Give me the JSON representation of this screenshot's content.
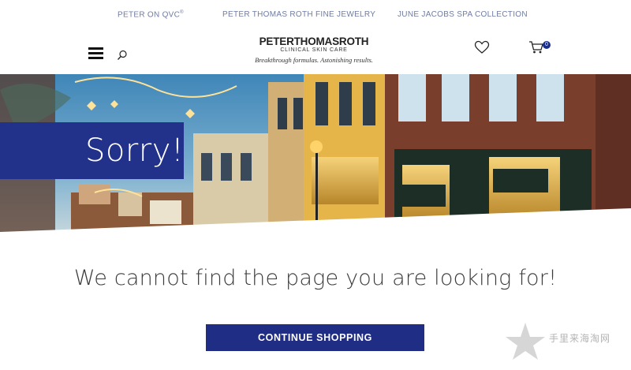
{
  "top_links": {
    "qvc": "PETER ON QVC",
    "qvc_mark": "®",
    "jewelry": "PETER THOMAS ROTH FINE JEWELRY",
    "spa": "JUNE JACOBS SPA COLLECTION"
  },
  "header": {
    "logo_brand": "PETERTHOMASROTH",
    "logo_sub": "CLINICAL SKIN CARE",
    "logo_tagline": "Breakthrough formulas. Astonishing results.",
    "cart_count": "0",
    "icons": [
      "menu-icon",
      "search-icon",
      "heart-icon",
      "cart-icon"
    ]
  },
  "hero": {
    "heading": "Sorry!",
    "accent_color": "#22318a"
  },
  "main": {
    "message": "We cannot find the page you are looking for!",
    "cta_label": "CONTINUE SHOPPING"
  },
  "watermark": {
    "text": "手里来海淘网"
  }
}
